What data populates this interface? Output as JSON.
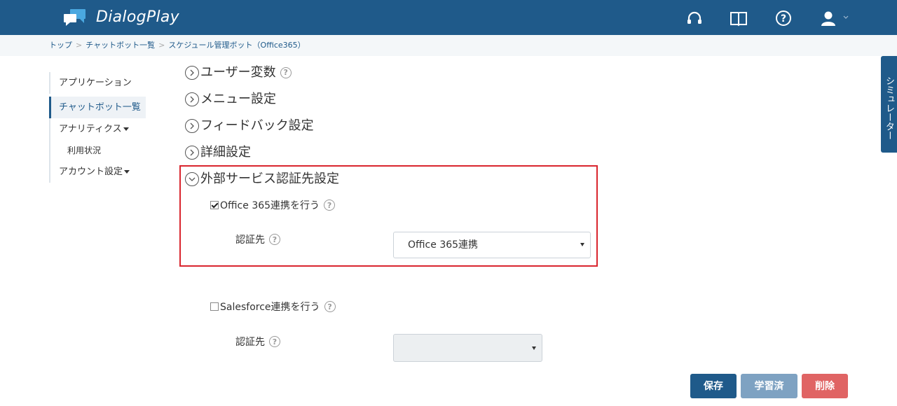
{
  "header": {
    "brand": "DialogPlay",
    "icons": [
      "headset-icon",
      "book-icon",
      "help-icon",
      "user-icon"
    ]
  },
  "breadcrumb": {
    "items": [
      "トップ",
      "チャットボット一覧",
      "スケジュール管理ボット（Office365）"
    ],
    "separator": ">"
  },
  "sidebar": {
    "applications": "アプリケーション",
    "chatbots": "チャットボット一覧",
    "analytics": "アナリティクス",
    "usage": "利用状況",
    "account": "アカウント設定"
  },
  "sections": {
    "user_vars": "ユーザー変数",
    "menu": "メニュー設定",
    "feedback": "フィードバック設定",
    "details": "詳細設定",
    "external_auth": "外部サービス認証先設定"
  },
  "office365": {
    "checkbox_label": "Office 365連携を行う",
    "checked": true,
    "auth_label": "認証先",
    "selected": "Office 365連携"
  },
  "salesforce": {
    "checkbox_label": "Salesforce連携を行う",
    "checked": false,
    "auth_label": "認証先",
    "selected": ""
  },
  "simulator_tab": "シミュレーター",
  "buttons": {
    "save": "保存",
    "learned": "学習済",
    "delete": "削除"
  },
  "colors": {
    "header_bg": "#1f5a8a",
    "highlight_border": "#d9252e",
    "save_btn": "#1f5a8a",
    "learned_btn": "#7ea2c2",
    "delete_btn": "#e06464"
  }
}
